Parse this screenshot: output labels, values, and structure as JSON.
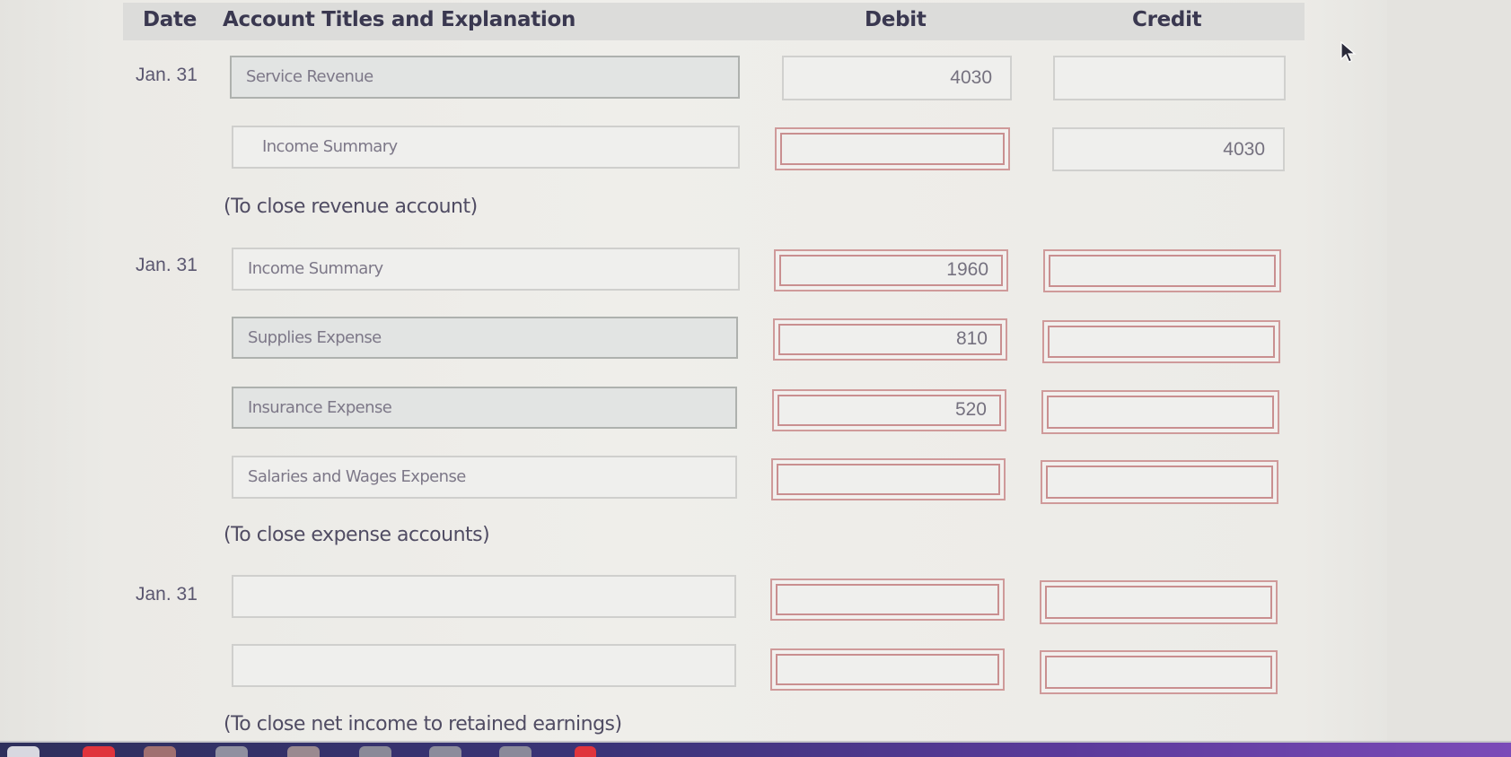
{
  "header": {
    "date": "Date",
    "account": "Account Titles and Explanation",
    "debit": "Debit",
    "credit": "Credit"
  },
  "entries": [
    {
      "date": "Jan. 31",
      "lines": [
        {
          "account": "Service Revenue",
          "debit": "4030",
          "credit": ""
        },
        {
          "account": "Income Summary",
          "debit": "",
          "credit": "4030"
        }
      ],
      "explanation": "(To close revenue account)"
    },
    {
      "date": "Jan. 31",
      "lines": [
        {
          "account": "Income Summary",
          "debit": "1960",
          "credit": ""
        },
        {
          "account": "Supplies Expense",
          "debit": "810",
          "credit": ""
        },
        {
          "account": "Insurance Expense",
          "debit": "520",
          "credit": ""
        },
        {
          "account": "Salaries and Wages Expense",
          "debit": "",
          "credit": ""
        }
      ],
      "explanation": "(To close expense accounts)"
    },
    {
      "date": "Jan. 31",
      "lines": [
        {
          "account": "",
          "debit": "",
          "credit": ""
        },
        {
          "account": "",
          "debit": "",
          "credit": ""
        }
      ],
      "explanation": "(To close net income to retained earnings)"
    }
  ],
  "colors": {
    "error_border": "#c98f90",
    "header_bg": "#dcdcda",
    "taskbar": "#3a3478"
  }
}
